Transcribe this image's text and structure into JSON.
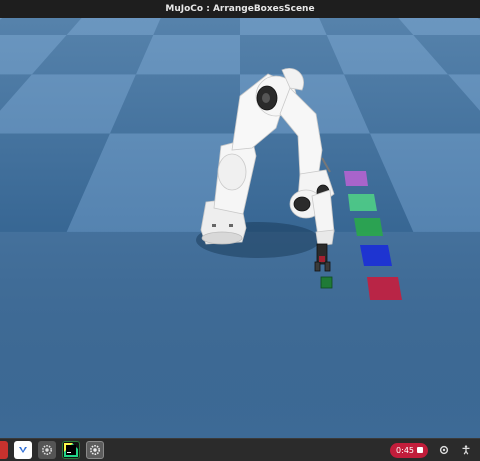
{
  "window": {
    "title": "MuJoCo : ArrangeBoxesScene"
  },
  "scene": {
    "floor_color_light": "#4f7eac",
    "floor_color_dark": "#2f5f8d",
    "robot_color": "#f2f2f2",
    "targets": [
      {
        "name": "violet-target",
        "color": "#b463d0"
      },
      {
        "name": "light-green-target",
        "color": "#4fce86"
      },
      {
        "name": "green-target",
        "color": "#2aa84a"
      },
      {
        "name": "blue-target",
        "color": "#1b2fd6"
      },
      {
        "name": "red-target",
        "color": "#c3203f"
      }
    ]
  },
  "taskbar": {
    "apps": [
      {
        "name": "vscode-icon"
      },
      {
        "name": "settings-gear-icon"
      },
      {
        "name": "pycharm-icon"
      },
      {
        "name": "mujoco-gear-icon"
      }
    ],
    "recording_time": "0:45",
    "accent_color": "#c21d3b"
  }
}
